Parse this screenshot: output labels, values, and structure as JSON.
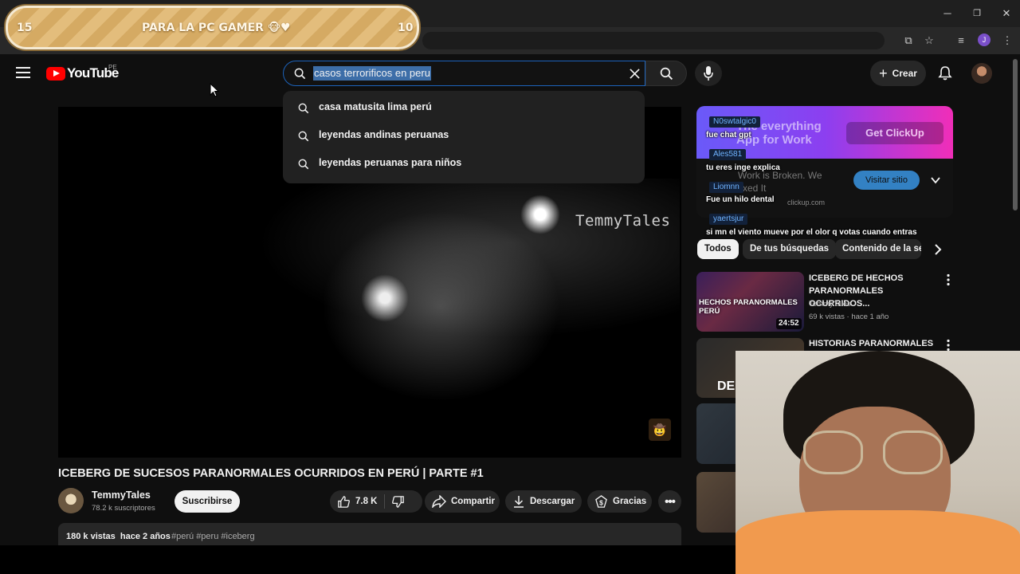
{
  "overlay": {
    "left_count": "15",
    "title": "PARA LA PC GAMER 🐵♥",
    "right_count": "10"
  },
  "browser": {
    "window_controls": [
      "minimize",
      "restore",
      "close"
    ],
    "profile_initial": "J"
  },
  "header": {
    "logo_text": "YouTube",
    "country_code": "PE",
    "search_query": "casos terrorificos en peru",
    "create_label": "Crear"
  },
  "suggestions": [
    "casa matusita lima perú",
    "leyendas andinas peruanas",
    "leyendas peruanas para niños"
  ],
  "video": {
    "watermark": "TemmyTales",
    "title": "ICEBERG DE SUCESOS PARANORMALES OCURRIDOS EN PERÚ | PARTE #1",
    "channel_name": "TemmyTales",
    "subscribers": "78.2 k suscriptores",
    "subscribe_label": "Suscribirse",
    "likes": "7.8 K",
    "share_label": "Compartir",
    "download_label": "Descargar",
    "thanks_label": "Gracias",
    "views": "180 k vistas",
    "age": "hace 2 años",
    "tags": "#perú #peru #iceberg"
  },
  "ad": {
    "headline": "The everything App for Work",
    "cta_get": "Get ClickUp",
    "body": "Work is Broken. We fixed It",
    "sponsored_prefix": "Patrocinado",
    "domain": "clickup.com",
    "visit_label": "Visitar sitio"
  },
  "chat": [
    {
      "user": "N0swtalgic0",
      "message": "fue chat gpt"
    },
    {
      "user": "Ales581",
      "message": "tu eres inge explica"
    },
    {
      "user": "Liomnn",
      "message": "Fue un hilo dental"
    },
    {
      "user": "yaertsjur",
      "message": "si mn el viento mueve por el olor q votas cuando entras"
    }
  ],
  "chips": [
    "Todos",
    "De tus búsquedas",
    "Contenido de la ser"
  ],
  "recommendations": [
    {
      "title": "ICEBERG DE HECHOS PARANORMALES OCURRIDOS...",
      "channel": "TemmyTales",
      "meta": "69 k vistas · hace 1 año",
      "duration": "24:52",
      "thumb_text": "HECHOS PARANORMALES PERÚ"
    },
    {
      "title": "HISTORIAS PARANORMALES",
      "thumb_text": "DE"
    }
  ],
  "colors": {
    "accent_blue": "#3ea6ff",
    "yt_red": "#ff0000",
    "search_border": "#1c62b9"
  }
}
